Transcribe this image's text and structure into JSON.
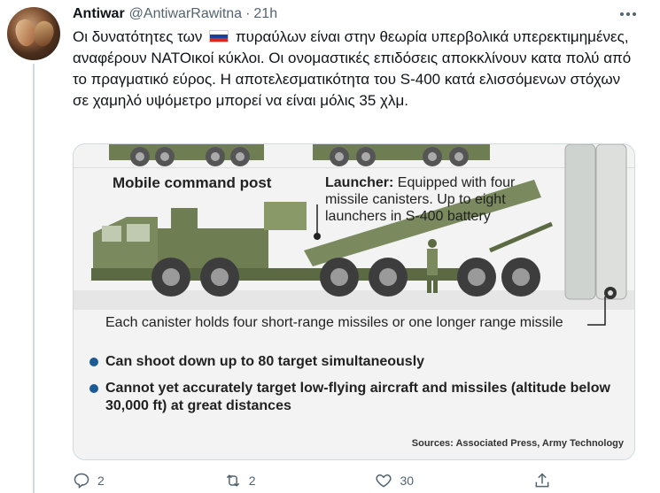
{
  "tweet": {
    "author_name": "Antiwar",
    "author_handle": "@AntiwarRawitna",
    "separator": "·",
    "time": "21h",
    "text_before_flag": "Οι δυνατότητες των",
    "flag_icon": "russia-flag-icon",
    "text_after_flag": "πυραύλων είναι στην θεωρία υπερβολικά υπερεκτιμημένες, αναφέρουν ΝΑΤΟικοί κύκλοι. Οι ονομαστικές επιδόσεις αποκκλίνουν κατα πολύ από το πραγματικό εύρος. Η αποτελεσματικότητα του S-400 κατά ελισσόμενων στόχων σε χαμηλό υψόμετρο μπορεί να είναι μόλις 35 χλμ."
  },
  "infographic": {
    "mobile_command_post": "Mobile command post",
    "launcher_title": "Launcher:",
    "launcher_text": "Equipped with four missile canisters. Up to eight launchers in S-400 battery",
    "canister_note": "Each canister holds four short-range missiles or one longer range missile",
    "bullets": [
      "Can shoot down up to 80 target simultaneously",
      "Cannot yet accurately target low-flying aircraft and missiles (altitude below 30,000 ft) at great distances"
    ],
    "sources": "Sources: Associated Press, Army Technology",
    "colors": {
      "vehicle": "#7b8a5e",
      "bullet": "#1b5a94"
    }
  },
  "actions": {
    "reply_count": "2",
    "retweet_count": "2",
    "like_count": "30"
  }
}
